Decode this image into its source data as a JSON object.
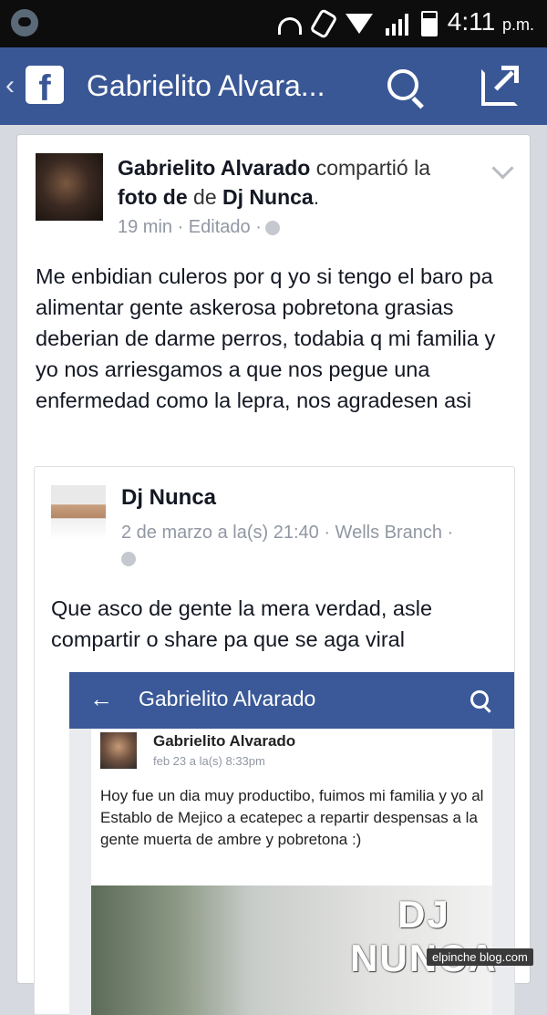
{
  "status_bar": {
    "time": "4:11",
    "ampm": "p.m."
  },
  "header": {
    "back_glyph": "‹",
    "logo_letter": "f",
    "title": "Gabrielito Alvara...",
    "search_icon": "search-icon",
    "share_icon": "share-icon"
  },
  "post": {
    "author": "Gabrielito Alvarado",
    "action": "compartió la",
    "object_prefix": "foto de",
    "object_author": "Dj Nunca",
    "object_suffix": ".",
    "meta": "19 min · Editado ·",
    "text": "Me enbidian culeros por q yo si tengo el baro pa alimentar gente askerosa pobretona grasias deberian de darme perros, todabia q mi familia y yo nos arriesgamos a que nos pegue una enfermedad como la lepra, nos agradesen asi"
  },
  "shared": {
    "author": "Dj Nunca",
    "meta": "2 de marzo a la(s) 21:40 · Wells Branch ·",
    "text": "Que asco de gente la mera verdad, asle compartir o share pa que se aga viral"
  },
  "screenshot": {
    "back_glyph": "←",
    "title": "Gabrielito Alvarado",
    "author": "Gabrielito Alvarado",
    "meta": "feb 23 a la(s) 8:33pm",
    "text": "Hoy fue un dia muy productibo, fuimos mi familia y yo al Establo de Mejico a ecatepec a repartir despensas a la gente muerta de ambre y pobretona :)",
    "logo_text": "DJ NUNCA"
  },
  "watermark": "elpinche blog.com",
  "colors": {
    "facebook_blue": "#3a5795",
    "text_dark": "#141823",
    "meta_gray": "#9197a3"
  }
}
